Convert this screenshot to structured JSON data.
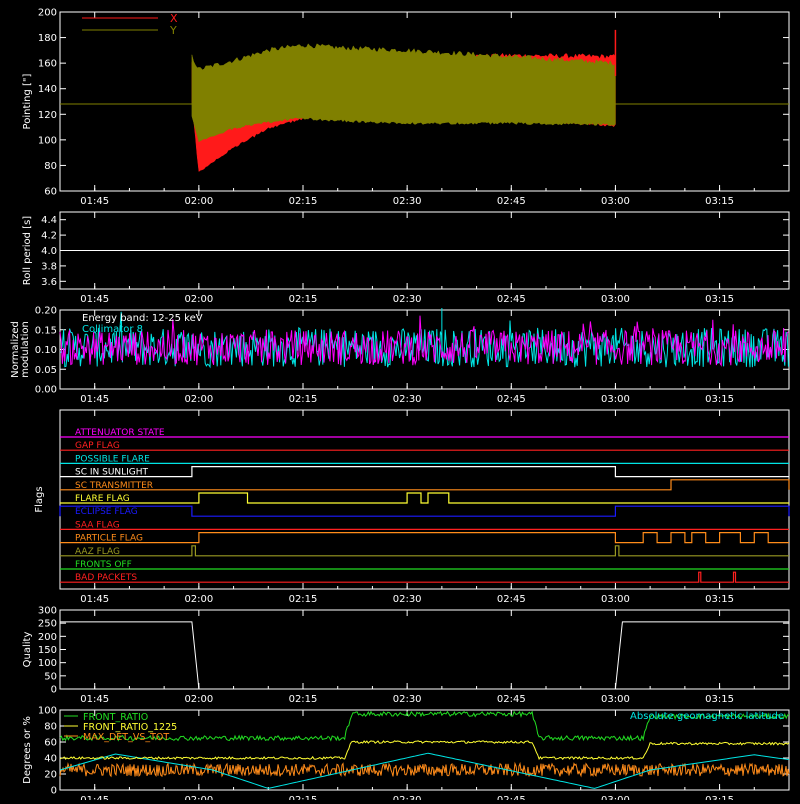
{
  "colors": {
    "background": "#000000",
    "axes": "#ffffff",
    "x_series": "#ff1a1a",
    "y_series": "#808000",
    "cyan": "#00e5e5",
    "magenta": "#ff00ff",
    "green": "#22dd22",
    "yellow": "#ffff33",
    "orange": "#ff8c1a",
    "red": "#ff2020",
    "blue": "#1a1aff",
    "olive": "#999922"
  },
  "time_axis": {
    "start": "01:40",
    "end": "03:25",
    "ticks": [
      "01:45",
      "02:00",
      "02:15",
      "02:30",
      "02:45",
      "03:00",
      "03:15"
    ]
  },
  "chart_data": [
    {
      "name": "pointing",
      "type": "area",
      "ylabel": "Pointing [\"]",
      "ylim": [
        60,
        200
      ],
      "yticks": [
        "60",
        "80",
        "100",
        "120",
        "140",
        "160",
        "180",
        "200"
      ],
      "legend": [
        {
          "label": "X",
          "color": "#ff1a1a"
        },
        {
          "label": "Y",
          "color": "#808000"
        }
      ],
      "reference_line": 128,
      "data_window": [
        "01:59",
        "03:00"
      ],
      "x_band": {
        "times": [
          "01:59",
          "02:00",
          "02:05",
          "02:10",
          "02:15",
          "02:20",
          "02:30",
          "02:45",
          "03:00"
        ],
        "upper": [
          160,
          118,
          150,
          156,
          160,
          162,
          164,
          166,
          165
        ],
        "lower": [
          130,
          76,
          95,
          110,
          118,
          120,
          122,
          118,
          112
        ]
      },
      "y_band": {
        "times": [
          "01:59",
          "02:00",
          "02:05",
          "02:10",
          "02:15",
          "02:20",
          "02:30",
          "02:45",
          "03:00"
        ],
        "upper": [
          165,
          155,
          162,
          170,
          174,
          172,
          170,
          165,
          160
        ],
        "lower": [
          120,
          100,
          110,
          115,
          118,
          116,
          114,
          114,
          113
        ]
      },
      "spike": {
        "time": "03:00",
        "value": 186
      }
    },
    {
      "name": "roll-period",
      "type": "line",
      "ylabel": "Roll period [s]",
      "ylim": [
        3.5,
        4.5
      ],
      "yticks": [
        "3.6",
        "3.8",
        "4.0",
        "4.2",
        "4.4"
      ],
      "value": 4.0
    },
    {
      "name": "modulation",
      "type": "line",
      "ylabel": "Normalized modulation",
      "ylim": [
        0,
        0.2
      ],
      "yticks": [
        "0.00",
        "0.05",
        "0.10",
        "0.15",
        "0.20"
      ],
      "annotations": [
        {
          "text": "Energy band: 12-25 keV",
          "color": "#ffffff"
        },
        {
          "text": "Collimator 8",
          "color": "#00e5e5"
        }
      ],
      "series": [
        {
          "color": "#00e5e5",
          "mean": 0.105,
          "spread": 0.05
        },
        {
          "color": "#ff00ff",
          "mean": 0.105,
          "spread": 0.045
        }
      ],
      "peak": {
        "time": "02:35",
        "value": 0.205
      }
    },
    {
      "name": "flags",
      "type": "line",
      "ylabel": "Flags",
      "flags": [
        {
          "label": "ATTENUATOR STATE",
          "color": "#ff00ff",
          "on": []
        },
        {
          "label": "GAP FLAG",
          "color": "#ff2020",
          "on": []
        },
        {
          "label": "POSSIBLE FLARE",
          "color": "#00e5e5",
          "on": []
        },
        {
          "label": "SC IN SUNLIGHT",
          "color": "#ffffff",
          "on": [
            [
              "01:59",
              "03:00"
            ]
          ]
        },
        {
          "label": "SC TRANSMITTER",
          "color": "#ff8c1a",
          "on": [
            [
              "03:08",
              "03:25"
            ]
          ]
        },
        {
          "label": "FLARE FLAG",
          "color": "#ffff33",
          "on": [
            [
              "02:00",
              "02:07"
            ],
            [
              "02:30",
              "02:32"
            ],
            [
              "02:33",
              "02:36"
            ]
          ]
        },
        {
          "label": "ECLIPSE FLAG",
          "color": "#1a1aff",
          "on": [
            [
              "01:40",
              "01:59"
            ],
            [
              "03:00",
              "03:25"
            ]
          ]
        },
        {
          "label": "SAA FLAG",
          "color": "#ff2020",
          "on": []
        },
        {
          "label": "PARTICLE FLAG",
          "color": "#ff8c1a",
          "on": [
            [
              "02:00",
              "03:00"
            ],
            [
              "03:04",
              "03:06"
            ],
            [
              "03:08",
              "03:10"
            ],
            [
              "03:11",
              "03:13"
            ],
            [
              "03:15",
              "03:18"
            ],
            [
              "03:20",
              "03:22"
            ]
          ]
        },
        {
          "label": "AAZ FLAG",
          "color": "#999922",
          "on": [
            [
              "01:59",
              "01:59.5"
            ],
            [
              "03:00",
              "03:00.5"
            ]
          ]
        },
        {
          "label": "FRONTS OFF",
          "color": "#22dd22",
          "on": []
        },
        {
          "label": "BAD PACKETS",
          "color": "#ff2020",
          "on": [
            [
              "03:12",
              "03:12.3"
            ],
            [
              "03:17",
              "03:17.3"
            ]
          ]
        }
      ]
    },
    {
      "name": "quality",
      "type": "line",
      "ylabel": "Quality",
      "ylim": [
        0,
        300
      ],
      "yticks": [
        "0",
        "50",
        "100",
        "150",
        "200",
        "250",
        "300"
      ],
      "times": [
        "01:40",
        "01:59",
        "02:00",
        "03:00",
        "03:01",
        "03:25"
      ],
      "values": [
        255,
        255,
        0,
        0,
        255,
        255
      ]
    },
    {
      "name": "ratios",
      "type": "line",
      "ylabel": "Degrees or %",
      "ylim": [
        0,
        100
      ],
      "yticks": [
        "0",
        "20",
        "40",
        "60",
        "80",
        "100"
      ],
      "legend_left": [
        {
          "label": "FRONT_RATIO",
          "color": "#22dd22"
        },
        {
          "label": "FRONT_RATIO_1225",
          "color": "#ffff33"
        },
        {
          "label": "MAX_DET_VS_TOT",
          "color": "#ff8c1a"
        }
      ],
      "legend_right": {
        "label": "Absolute geomagnetic latitude",
        "color": "#00e5e5"
      },
      "front_ratio": {
        "times": [
          "01:40",
          "02:21",
          "02:22",
          "02:48",
          "02:49",
          "03:04",
          "03:05",
          "03:25"
        ],
        "values": [
          65,
          65,
          95,
          95,
          65,
          65,
          92,
          92
        ]
      },
      "front_ratio_1225": {
        "times": [
          "01:40",
          "02:21",
          "02:22",
          "02:48",
          "02:49",
          "03:04",
          "03:05",
          "03:25"
        ],
        "values": [
          40,
          40,
          60,
          60,
          40,
          40,
          58,
          58
        ]
      },
      "max_det_vs_tot": {
        "mean": 25,
        "spread": 8
      },
      "geomag": {
        "times": [
          "01:40",
          "01:48",
          "02:02",
          "02:10",
          "02:33",
          "02:57",
          "03:05",
          "03:20",
          "03:25"
        ],
        "values": [
          25,
          45,
          25,
          2,
          46,
          2,
          25,
          44,
          38
        ]
      }
    }
  ]
}
